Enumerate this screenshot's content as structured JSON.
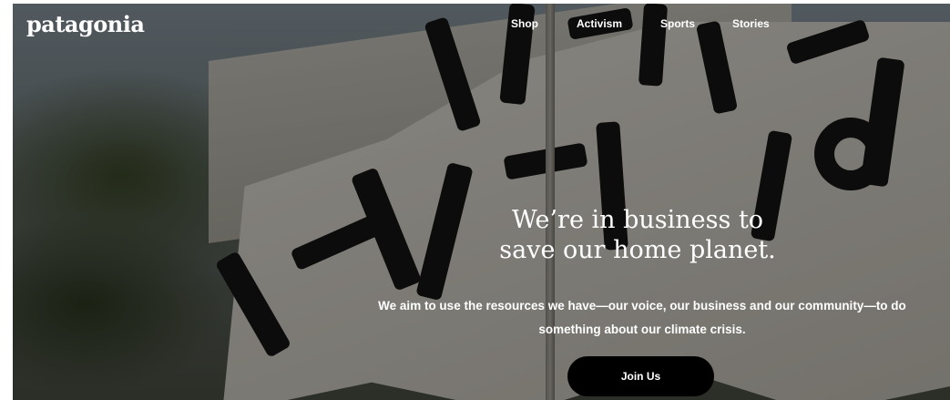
{
  "brand": {
    "logo_text": "patagonia"
  },
  "nav": {
    "items": [
      {
        "label": "Shop"
      },
      {
        "label": "Activism"
      },
      {
        "label": "Sports"
      },
      {
        "label": "Stories"
      }
    ]
  },
  "hero": {
    "headline_line1": "We’re in business to",
    "headline_line2": "save our home planet.",
    "lead": "We aim to use the resources we have—our voice, our business and our community—to do something about our climate crisis.",
    "cta_label": "Join Us",
    "image_description_icon": "protest-banner-image"
  },
  "colors": {
    "text": "#ffffff",
    "button_bg": "#000000",
    "button_text": "#ffffff"
  }
}
